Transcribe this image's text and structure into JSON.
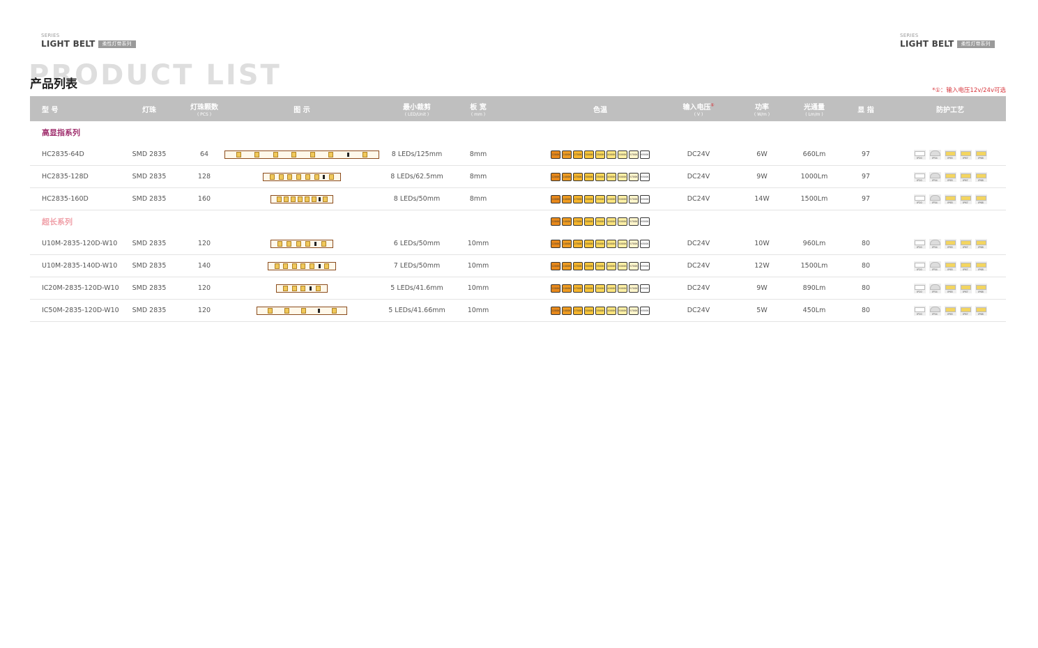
{
  "header": {
    "series_label": "SERIES",
    "brand_name": "LIGHT BELT",
    "brand_tag": "柔性灯带系列",
    "bg_title": "PRODUCT LIST",
    "cn_title": "产品列表",
    "note": "*①：输入电压12v/24v可选"
  },
  "columns": {
    "model": "型 号",
    "led": "灯珠",
    "count": "灯珠颗数",
    "count_unit": "( PCS )",
    "image": "图 示",
    "cut": "最小裁剪",
    "cut_unit": "( LED/Unit )",
    "width": "板 宽",
    "width_unit": "( mm )",
    "cct": "色温",
    "voltage": "输入电压",
    "voltage_mark": "①",
    "voltage_unit": "( V )",
    "power": "功率",
    "power_unit": "( W/m )",
    "flux": "光通量",
    "flux_unit": "( Lm/m )",
    "cri": "显 指",
    "ip": "防护工艺"
  },
  "colors": {
    "header_bg": "#bfbfbf",
    "cat1": "#a0306e",
    "cat2": "#f0a0a8",
    "note": "#d7373d"
  },
  "cct_labels": [
    "2200K",
    "2400K",
    "2700K",
    "3000K",
    "3500K",
    "4000K",
    "5000K",
    "5700K",
    "6500K"
  ],
  "cct_colors": [
    "#e8891b",
    "#ef9c22",
    "#f6b52c",
    "#f9c63a",
    "#fbd85a",
    "#fde57f",
    "#fef0a6",
    "#fff6cc",
    "#ffffff"
  ],
  "ip_labels": [
    "IP20",
    "IP54",
    "IP65",
    "IP67",
    "IP68"
  ],
  "categories": [
    {
      "name": "高显指系列",
      "rows": [
        {
          "model": "HC2835-64D",
          "led": "SMD 2835",
          "count": "64",
          "cut": "8 LEDs/125mm",
          "width": "8mm",
          "voltage": "DC24V",
          "power": "6W",
          "flux": "660Lm",
          "cri": "97"
        },
        {
          "model": "HC2835-128D",
          "led": "SMD 2835",
          "count": "128",
          "cut": "8 LEDs/62.5mm",
          "width": "8mm",
          "voltage": "DC24V",
          "power": "9W",
          "flux": "1000Lm",
          "cri": "97"
        },
        {
          "model": "HC2835-160D",
          "led": "SMD 2835",
          "count": "160",
          "cut": "8 LEDs/50mm",
          "width": "8mm",
          "voltage": "DC24V",
          "power": "14W",
          "flux": "1500Lm",
          "cri": "97"
        }
      ]
    },
    {
      "name": "超长系列",
      "rows": [
        {
          "model": "U10M-2835-120D-W10",
          "led": "SMD 2835",
          "count": "120",
          "cut": "6 LEDs/50mm",
          "width": "10mm",
          "voltage": "DC24V",
          "power": "10W",
          "flux": "960Lm",
          "cri": "80"
        },
        {
          "model": "U10M-2835-140D-W10",
          "led": "SMD 2835",
          "count": "140",
          "cut": "7 LEDs/50mm",
          "width": "10mm",
          "voltage": "DC24V",
          "power": "12W",
          "flux": "1500Lm",
          "cri": "80"
        },
        {
          "model": "IC20M-2835-120D-W10",
          "led": "SMD 2835",
          "count": "120",
          "cut": "5 LEDs/41.6mm",
          "width": "10mm",
          "voltage": "DC24V",
          "power": "9W",
          "flux": "890Lm",
          "cri": "80"
        },
        {
          "model": "IC50M-2835-120D-W10",
          "led": "SMD 2835",
          "count": "120",
          "cut": "5 LEDs/41.66mm",
          "width": "10mm",
          "voltage": "DC24V",
          "power": "5W",
          "flux": "450Lm",
          "cri": "80"
        }
      ]
    }
  ]
}
